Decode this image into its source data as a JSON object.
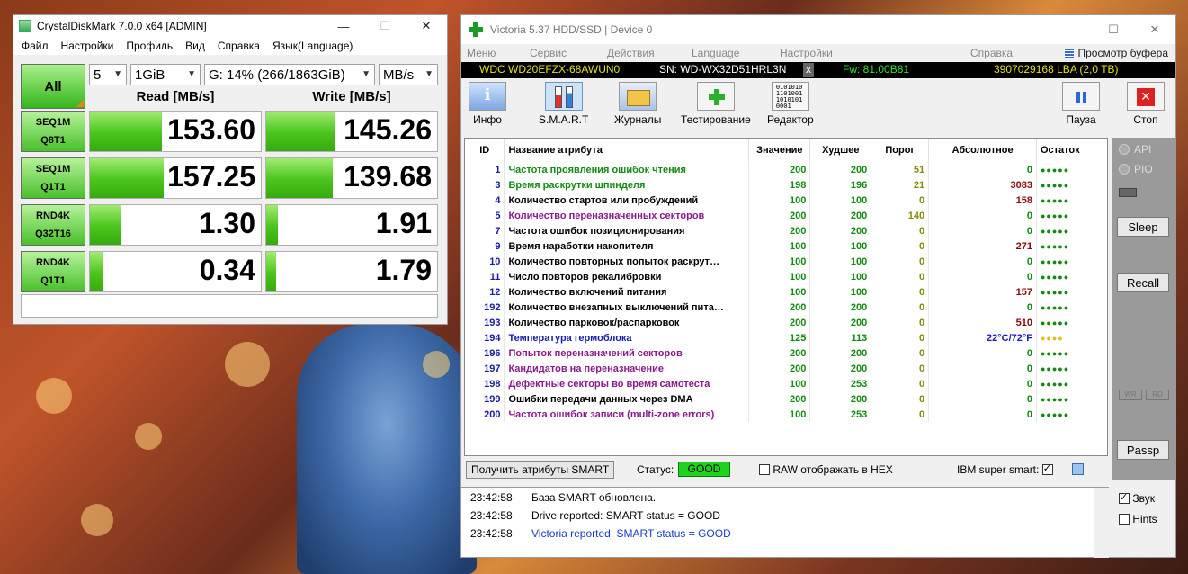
{
  "crystaldiskmark": {
    "title": "CrystalDiskMark 7.0.0 x64 [ADMIN]",
    "menu": [
      "Файл",
      "Настройки",
      "Профиль",
      "Вид",
      "Справка",
      "Язык(Language)"
    ],
    "all_label": "All",
    "count": "5",
    "size": "1GiB",
    "drive": "G: 14% (266/1863GiB)",
    "unit": "MB/s",
    "read_header": "Read [MB/s]",
    "write_header": "Write [MB/s]",
    "rows": [
      {
        "l1": "SEQ1M",
        "l2": "Q8T1",
        "read": "153.60",
        "read_pct": 0.42,
        "write": "145.26",
        "write_pct": 0.4
      },
      {
        "l1": "SEQ1M",
        "l2": "Q1T1",
        "read": "157.25",
        "read_pct": 0.43,
        "write": "139.68",
        "write_pct": 0.39
      },
      {
        "l1": "RND4K",
        "l2": "Q32T16",
        "read": "1.30",
        "read_pct": 0.18,
        "write": "1.91",
        "write_pct": 0.07
      },
      {
        "l1": "RND4K",
        "l2": "Q1T1",
        "read": "0.34",
        "read_pct": 0.08,
        "write": "1.79",
        "write_pct": 0.06
      }
    ]
  },
  "victoria": {
    "title": "Victoria 5.37 HDD/SSD | Device 0",
    "menu": [
      "Меню",
      "Сервис",
      "Действия",
      "Language",
      "Настройки",
      "Справка"
    ],
    "buffer_view": "Просмотр буфера",
    "model": "WDC WD20EFZX-68AWUN0",
    "serial": "SN: WD-WX32D51HRL3N",
    "x_mark": "x",
    "firmware": "Fw: 81.00B81",
    "lba": "3907029168 LBA (2,0 TB)",
    "toolbar": [
      "Инфо",
      "S.M.A.R.T",
      "Журналы",
      "Тестирование",
      "Редактор",
      "Пауза",
      "Стоп"
    ],
    "editor_icon_text": "0101010\n1101001\n1010101\n0001",
    "columns": [
      "ID",
      "Название атрибута",
      "Значение",
      "Худшее",
      "Порог",
      "Абсолютное",
      "Остаток"
    ],
    "attributes": [
      {
        "id": "1",
        "name": "Частота проявления ошибок чтения",
        "value": "200",
        "worst": "200",
        "threshold": "51",
        "raw": "0",
        "rest": "●●●●●",
        "color": "green"
      },
      {
        "id": "3",
        "name": "Время раскрутки шпинделя",
        "value": "198",
        "worst": "196",
        "threshold": "21",
        "raw": "3083",
        "rest": "●●●●●",
        "color": "green"
      },
      {
        "id": "4",
        "name": "Количество стартов или пробуждений",
        "value": "100",
        "worst": "100",
        "threshold": "0",
        "raw": "158",
        "rest": "●●●●●",
        "color": "black"
      },
      {
        "id": "5",
        "name": "Количество переназначенных секторов",
        "value": "200",
        "worst": "200",
        "threshold": "140",
        "raw": "0",
        "rest": "●●●●●",
        "color": "purple"
      },
      {
        "id": "7",
        "name": "Частота ошибок позиционирования",
        "value": "200",
        "worst": "200",
        "threshold": "0",
        "raw": "0",
        "rest": "●●●●●",
        "color": "black"
      },
      {
        "id": "9",
        "name": "Время наработки накопителя",
        "value": "100",
        "worst": "100",
        "threshold": "0",
        "raw": "271",
        "rest": "●●●●●",
        "color": "black"
      },
      {
        "id": "10",
        "name": "Количество повторных попыток раскрут…",
        "value": "100",
        "worst": "100",
        "threshold": "0",
        "raw": "0",
        "rest": "●●●●●",
        "color": "black"
      },
      {
        "id": "11",
        "name": "Число повторов рекалибровки",
        "value": "100",
        "worst": "100",
        "threshold": "0",
        "raw": "0",
        "rest": "●●●●●",
        "color": "black"
      },
      {
        "id": "12",
        "name": "Количество включений питания",
        "value": "100",
        "worst": "100",
        "threshold": "0",
        "raw": "157",
        "rest": "●●●●●",
        "color": "black"
      },
      {
        "id": "192",
        "name": "Количество внезапных выключений пита…",
        "value": "200",
        "worst": "200",
        "threshold": "0",
        "raw": "0",
        "rest": "●●●●●",
        "color": "black"
      },
      {
        "id": "193",
        "name": "Количество парковок/распарковок",
        "value": "200",
        "worst": "200",
        "threshold": "0",
        "raw": "510",
        "rest": "●●●●●",
        "color": "black"
      },
      {
        "id": "194",
        "name": "Температура гермоблока",
        "value": "125",
        "worst": "113",
        "threshold": "0",
        "raw": "22°C/72°F",
        "rest": "●●●●",
        "color": "blue"
      },
      {
        "id": "196",
        "name": "Попыток переназначений секторов",
        "value": "200",
        "worst": "200",
        "threshold": "0",
        "raw": "0",
        "rest": "●●●●●",
        "color": "purple"
      },
      {
        "id": "197",
        "name": "Кандидатов на переназначение",
        "value": "200",
        "worst": "200",
        "threshold": "0",
        "raw": "0",
        "rest": "●●●●●",
        "color": "purple"
      },
      {
        "id": "198",
        "name": "Дефектные секторы во время самотеста",
        "value": "100",
        "worst": "253",
        "threshold": "0",
        "raw": "0",
        "rest": "●●●●●",
        "color": "purple"
      },
      {
        "id": "199",
        "name": "Ошибки передачи данных через DMA",
        "value": "200",
        "worst": "200",
        "threshold": "0",
        "raw": "0",
        "rest": "●●●●●",
        "color": "black"
      },
      {
        "id": "200",
        "name": "Частота ошибок записи (multi-zone errors)",
        "value": "100",
        "worst": "253",
        "threshold": "0",
        "raw": "0",
        "rest": "●●●●●",
        "color": "purple"
      }
    ],
    "get_attrs_button": "Получить атрибуты SMART",
    "status_label": "Статус:",
    "status_value": "GOOD",
    "raw_hex_label": "RAW отображать в HEX",
    "ibm_label": "IBM super smart:",
    "api_label": "API",
    "pio_label": "PIO",
    "sleep_button": "Sleep",
    "recall_button": "Recall",
    "passp_button": "Passp",
    "wr_label": "WR",
    "rd_label": "RD",
    "log": [
      {
        "time": "23:42:58",
        "text": "База SMART обновлена.",
        "color": "#000000"
      },
      {
        "time": "23:42:58",
        "text": "Drive reported: SMART status = GOOD",
        "color": "#000000"
      },
      {
        "time": "23:42:58",
        "text": "Victoria reported: SMART status = GOOD",
        "color": "#1a3ad0"
      }
    ],
    "sound_label": "Звук",
    "hints_label": "Hints"
  }
}
